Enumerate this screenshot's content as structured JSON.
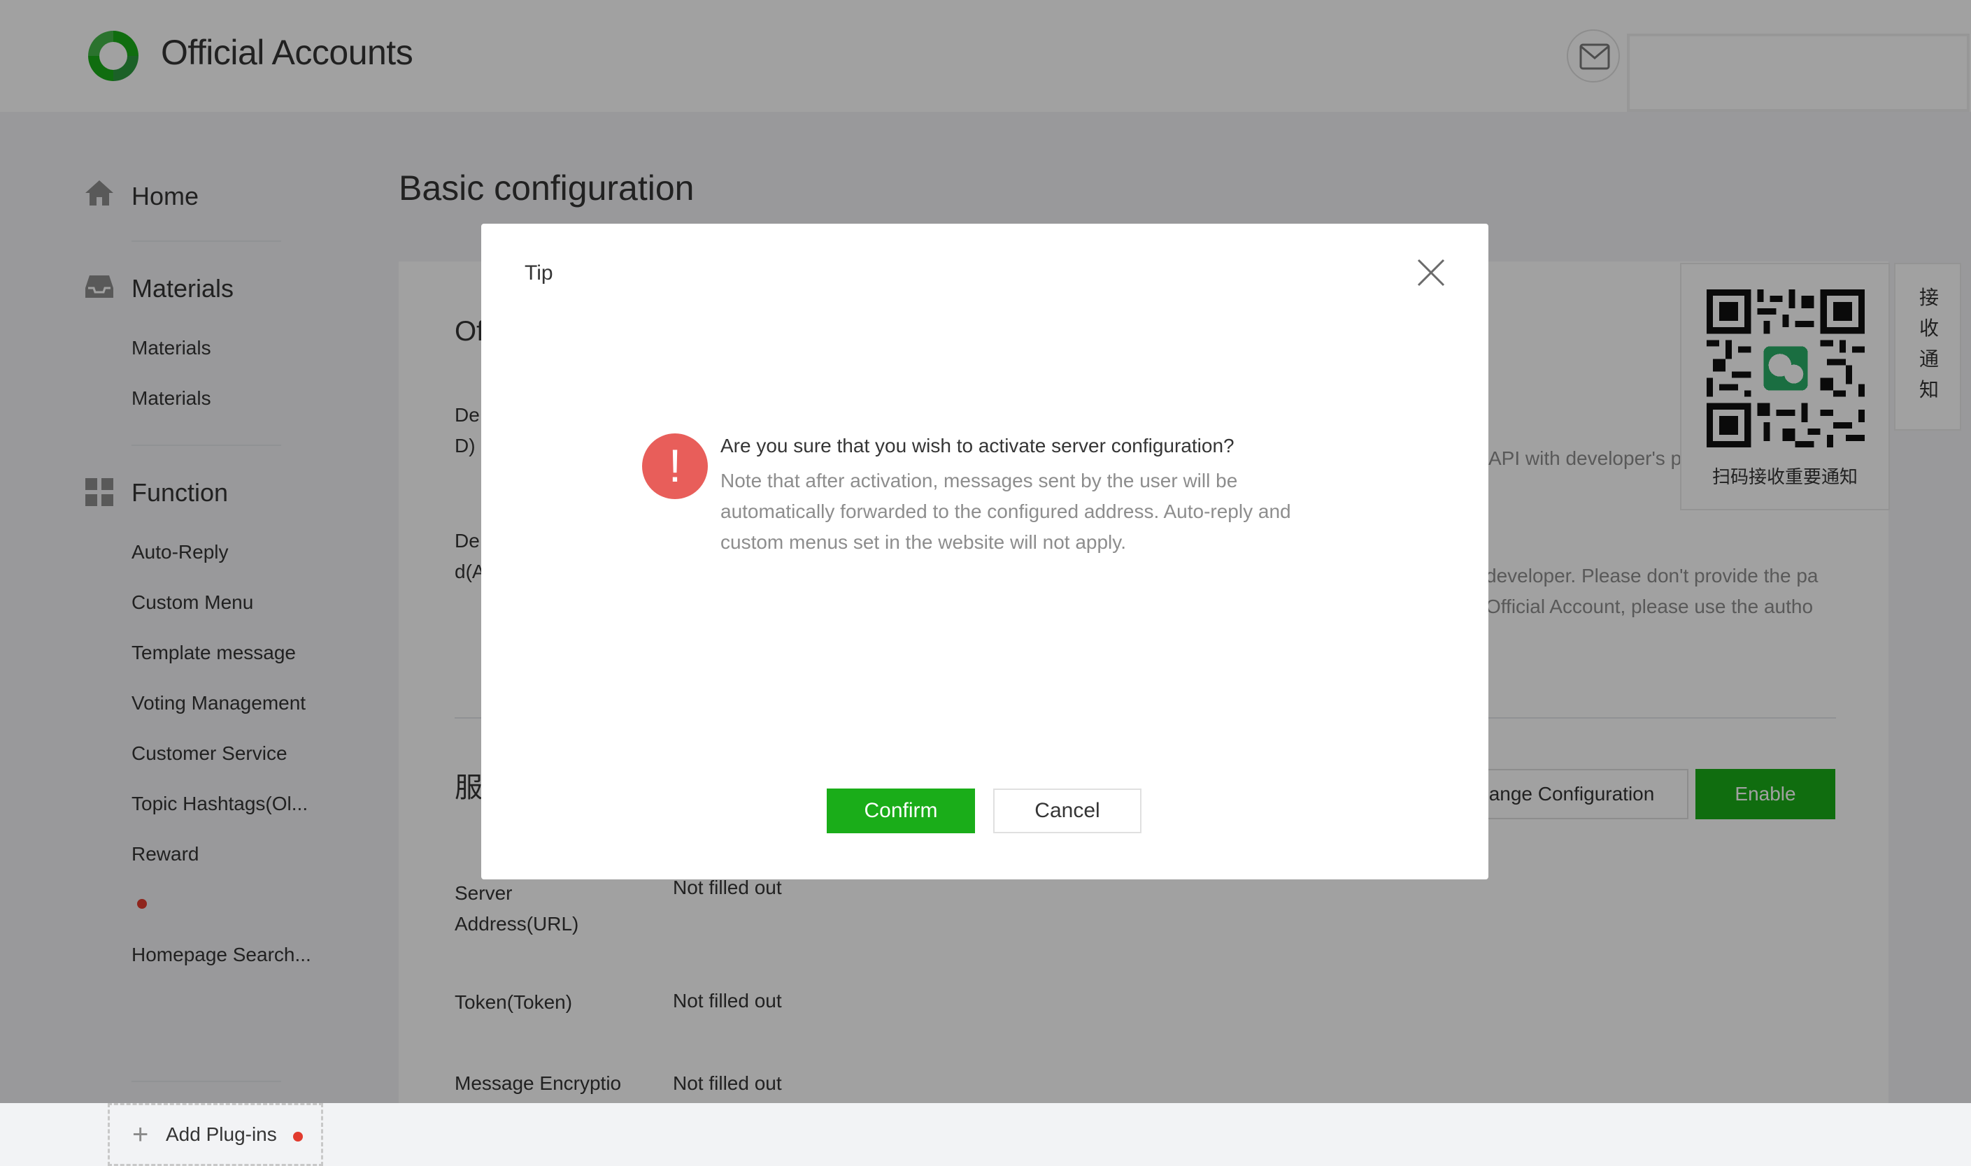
{
  "header": {
    "brand": "Official Accounts",
    "logo_icon": "official-accounts-logo",
    "mail_icon": "mail-icon"
  },
  "sidebar": {
    "groups": [
      {
        "title": "Home",
        "icon": "home-icon"
      },
      {
        "title": "Materials",
        "icon": "inbox-icon",
        "items": [
          "Materials",
          "Materials"
        ]
      },
      {
        "title": "Function",
        "icon": "grid-icon",
        "items": [
          "Auto-Reply",
          "Custom Menu",
          "Template message",
          "Voting Management",
          "Customer Service",
          "Topic Hashtags(Ol...",
          "Reward",
          "",
          "Homepage Search..."
        ]
      }
    ],
    "add_plugins": "Add Plug-ins"
  },
  "main": {
    "title": "Basic configuration",
    "section1_title_partial": "Of",
    "row1_label_line1": "De",
    "row1_label_line2": "D)",
    "row1_note": "API with developer's password.",
    "row2_label_line1": "De",
    "row2_label_line2": "d(A",
    "row2_note_line1": "developer. Please don't provide the pa",
    "row2_note_line2": "Official Account, please use the autho",
    "section2_title_partial": "服",
    "change_config_label": "ange Configuration",
    "enable_label": "Enable",
    "server_rows": [
      {
        "label": "Server Address(URL)",
        "value": "Not filled out"
      },
      {
        "label": "Token(Token)",
        "value": "Not filled out"
      },
      {
        "label": "Message Encryptio",
        "value": "Not filled out"
      }
    ]
  },
  "qr_panel": {
    "caption": "扫码接收重要通知",
    "side_tab_chars": [
      "接",
      "收",
      "通",
      "知"
    ]
  },
  "dialog": {
    "title": "Tip",
    "message": "Are you sure that you wish to activate server configuration?",
    "description": "Note that after activation, messages sent by the user will be automatically forwarded to the configured address. Auto-reply and custom menus set in the website will not apply.",
    "warning_symbol": "!",
    "confirm_label": "Confirm",
    "cancel_label": "Cancel"
  },
  "colors": {
    "accent_green": "#1aad19",
    "warning_red": "#e85e5a",
    "notification_dot": "#e23b2e"
  }
}
